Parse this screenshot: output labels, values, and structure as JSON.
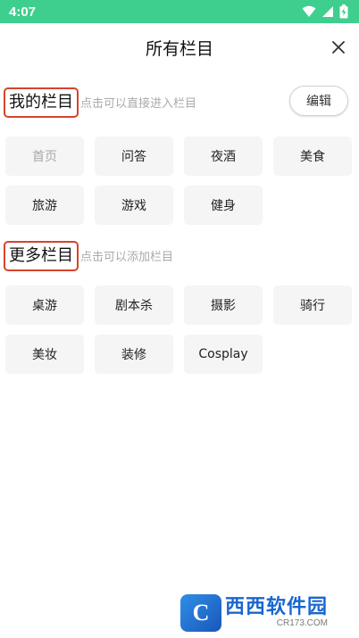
{
  "status_bar": {
    "time": "4:07",
    "bg_color": "#3ecf8e"
  },
  "header": {
    "title": "所有栏目",
    "close_icon": "close-icon"
  },
  "my_section": {
    "title": "我的栏目",
    "hint": "点击可以直接进入栏目",
    "edit_label": "编辑",
    "items": [
      {
        "label": "首页",
        "disabled": true
      },
      {
        "label": "问答"
      },
      {
        "label": "夜酒"
      },
      {
        "label": "美食"
      },
      {
        "label": "旅游"
      },
      {
        "label": "游戏"
      },
      {
        "label": "健身"
      }
    ]
  },
  "more_section": {
    "title": "更多栏目",
    "hint": "点击可以添加栏目",
    "items": [
      {
        "label": "桌游"
      },
      {
        "label": "剧本杀"
      },
      {
        "label": "摄影"
      },
      {
        "label": "骑行"
      },
      {
        "label": "美妆"
      },
      {
        "label": "装修"
      },
      {
        "label": "Cosplay"
      }
    ]
  },
  "watermark": {
    "logo_letter": "C",
    "main": "西西软件园",
    "sub": "CR173.COM"
  },
  "colors": {
    "highlight_border": "#d6442b",
    "chip_bg": "#f5f5f5",
    "hint_text": "#aaaaaa"
  }
}
